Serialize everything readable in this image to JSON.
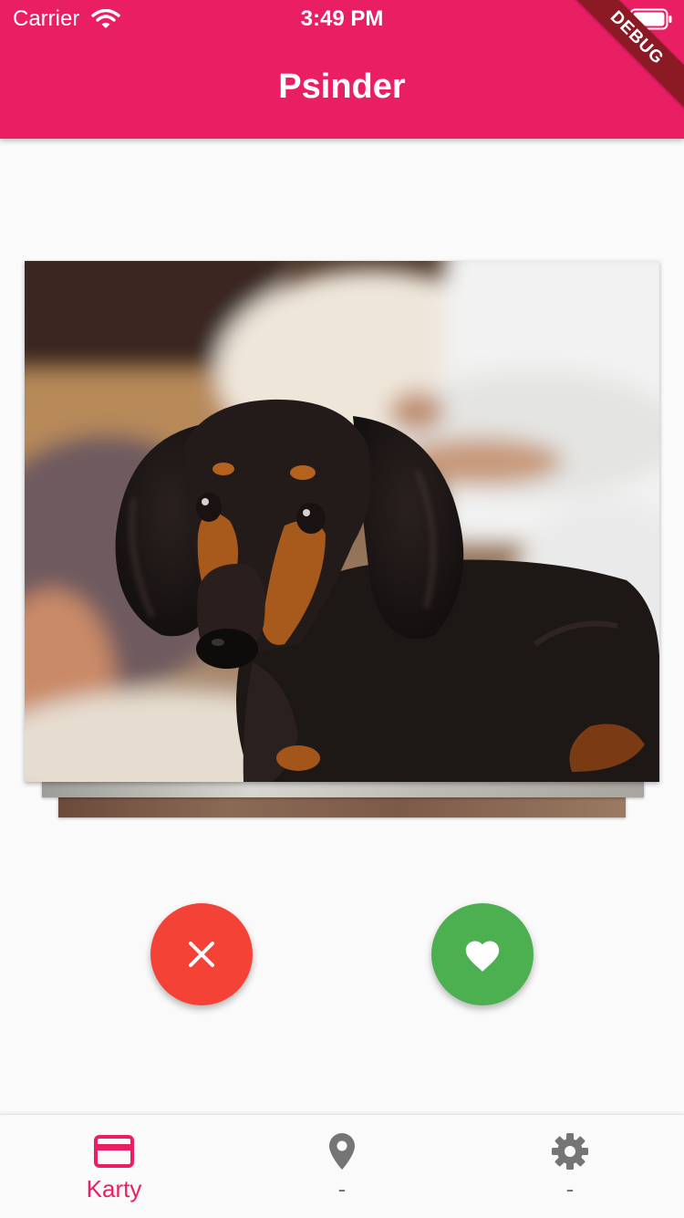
{
  "status_bar": {
    "carrier": "Carrier",
    "time": "3:49 PM"
  },
  "app_bar": {
    "title": "Psinder"
  },
  "debug_banner": "DEBUG",
  "card": {
    "image": "photo of a black-and-tan long-haired dachshund on a couch"
  },
  "actions": {
    "dislike": {
      "icon": "close-icon",
      "color": "#f44336"
    },
    "like": {
      "icon": "heart-icon",
      "color": "#4caf50"
    }
  },
  "bottom_nav": {
    "items": [
      {
        "label": "Karty",
        "icon": "credit-card-icon",
        "active": true
      },
      {
        "label": "-",
        "icon": "location-pin-icon",
        "active": false
      },
      {
        "label": "-",
        "icon": "gear-icon",
        "active": false
      }
    ]
  },
  "colors": {
    "primary": "#e91e63",
    "background": "#fafafa",
    "inactive": "#757575"
  }
}
